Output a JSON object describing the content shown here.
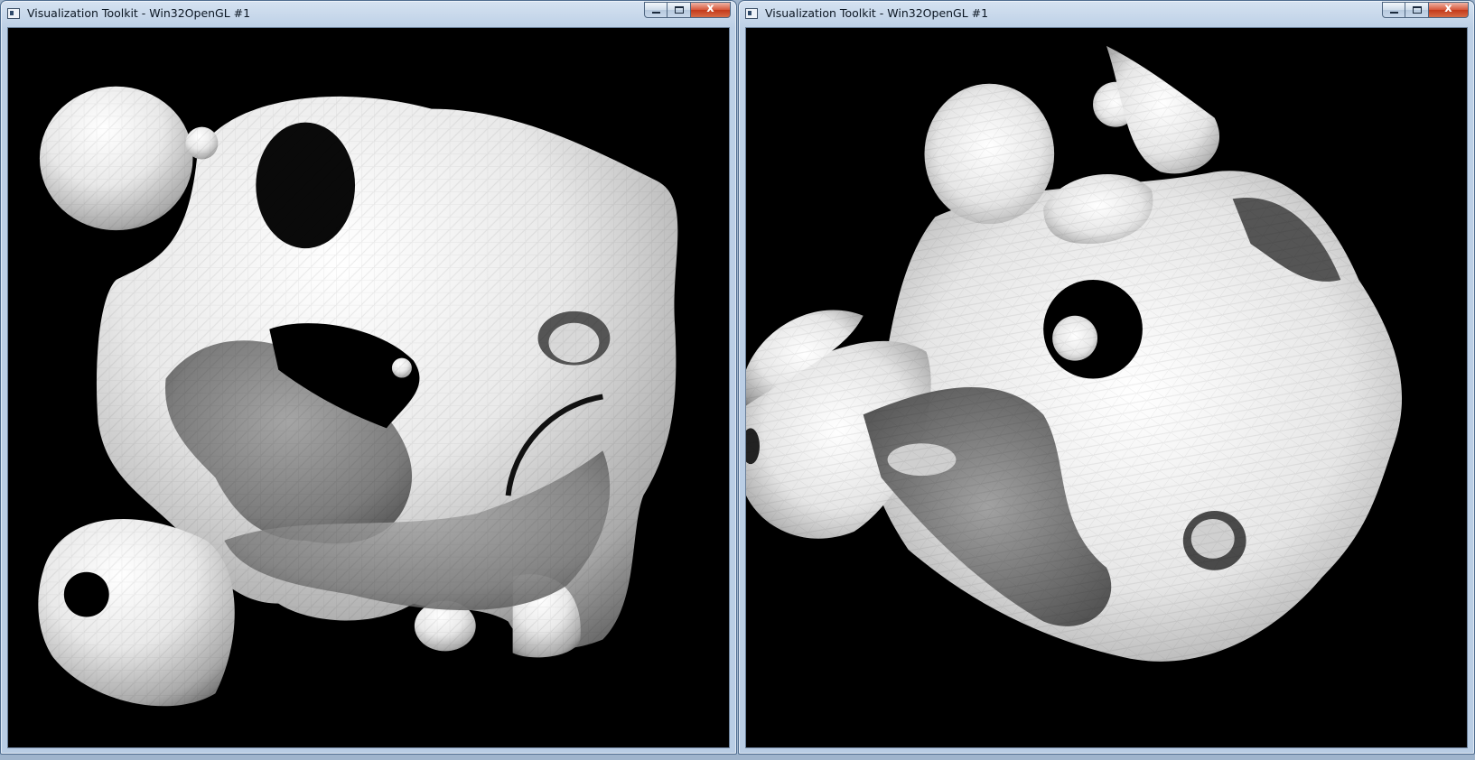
{
  "windows": [
    {
      "title": "Visualization Toolkit - Win32OpenGL #1",
      "render_view": "isosurface-render-front"
    },
    {
      "title": "Visualization Toolkit - Win32OpenGL #1",
      "render_view": "isosurface-render-rotated"
    }
  ],
  "caption_buttons": {
    "close_label": "x"
  },
  "icons": [
    "app-icon",
    "minimize-icon",
    "maximize-icon",
    "close-icon"
  ],
  "colors": {
    "render_background": "#000000",
    "surface": "#e6e6e6",
    "titlebar": "#c4d5ea"
  }
}
